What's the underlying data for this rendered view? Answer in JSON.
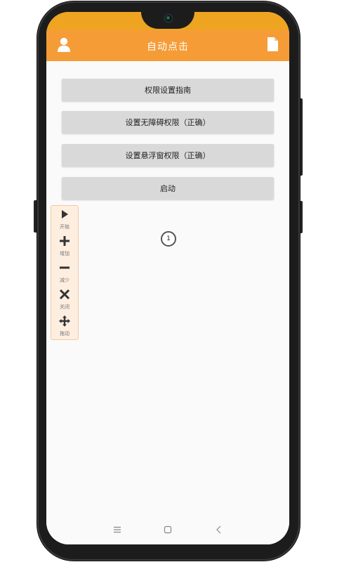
{
  "app": {
    "title": "自动点击",
    "header_color": "#f59c37",
    "status_color": "#eea421"
  },
  "header": {
    "left_icon": "user-icon",
    "right_icon": "file-icon"
  },
  "buttons": [
    {
      "label": "权限设置指南"
    },
    {
      "label": "设置无障碍权限（正确）"
    },
    {
      "label": "设置悬浮窗权限（正确）"
    },
    {
      "label": "启动"
    }
  ],
  "click_marker": {
    "number": "1"
  },
  "floating_toolbar": [
    {
      "icon": "play-icon",
      "label": "开始"
    },
    {
      "icon": "plus-icon",
      "label": "增加"
    },
    {
      "icon": "minus-icon",
      "label": "减少"
    },
    {
      "icon": "close-icon",
      "label": "关闭"
    },
    {
      "icon": "move-icon",
      "label": "拖动"
    }
  ],
  "nav": [
    "menu-icon",
    "home-icon",
    "back-icon"
  ]
}
